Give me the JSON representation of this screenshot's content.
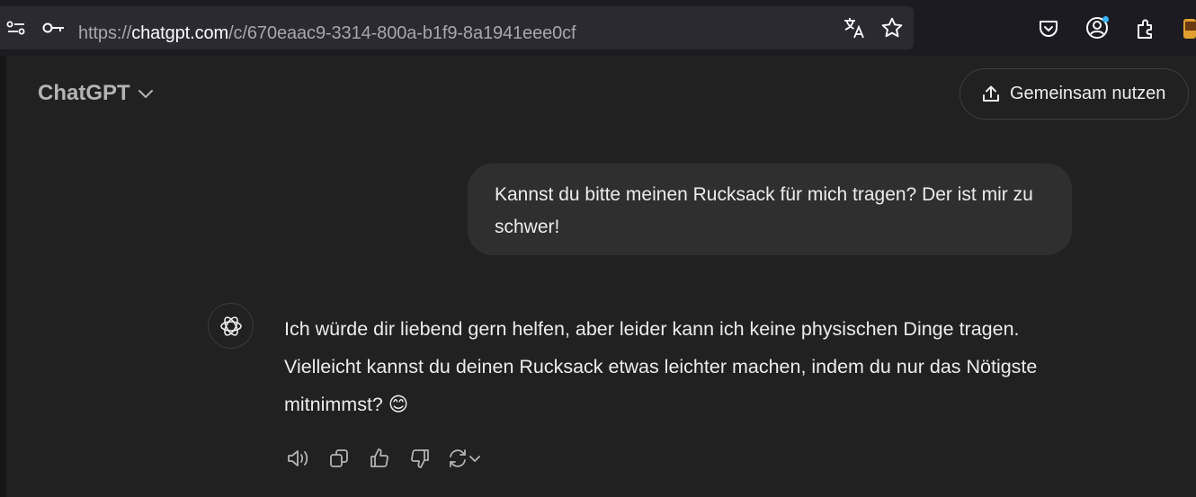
{
  "browser": {
    "url_prefix": "https://",
    "url_domain": "chatgpt.com",
    "url_path": "/c/670eaac9-3314-800a-b1f9-8a1941eee0cf"
  },
  "header": {
    "model_name": "ChatGPT",
    "share_label": "Gemeinsam nutzen"
  },
  "conversation": {
    "user_message": "Kannst du bitte meinen Rucksack für mich tragen? Der ist mir zu schwer!",
    "assistant_message": "Ich würde dir liebend gern helfen, aber leider kann ich keine physischen Dinge tragen. Vielleicht kannst du deinen Rucksack etwas leichter machen, indem du nur das Nötigste mitnimmst? 😊"
  },
  "colors": {
    "background": "#212121",
    "user_bubble": "#2f2f2f",
    "text": "#ececec",
    "accent_badge": "#35b6ff"
  }
}
